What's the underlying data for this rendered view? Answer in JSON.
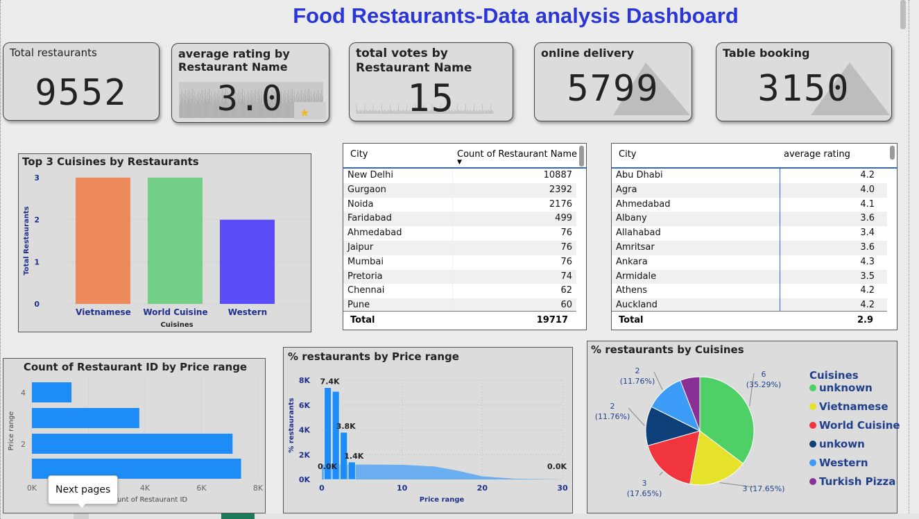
{
  "dashboard": {
    "title": "Food Restaurants-Data analysis Dashboard"
  },
  "kpis": {
    "total_restaurants": {
      "label": "Total restaurants",
      "value": "9552"
    },
    "avg_rating": {
      "label": "average rating by Restaurant Name",
      "value": "3.0"
    },
    "total_votes": {
      "label": "total votes by Restaurant Name",
      "value": "15"
    },
    "online_delivery": {
      "label": "online delivery",
      "value": "5799"
    },
    "table_booking": {
      "label": "Table booking",
      "value": "3150"
    }
  },
  "cuisines_chart": {
    "chart_data": {
      "type": "bar",
      "title": "Top 3 Cuisines by Restaurants",
      "categories": [
        "Vietnamese",
        "World Cuisine",
        "Western"
      ],
      "values": [
        3,
        3,
        2
      ],
      "xlabel": "Cuisines",
      "ylabel": "Total Restaurants",
      "ylim": [
        0,
        3
      ],
      "yticks": [
        "0",
        "1",
        "2",
        "3"
      ],
      "colors": [
        "#ec8a5c",
        "#72cf85",
        "#5a4cf6"
      ]
    }
  },
  "city_count_table": {
    "col1": "City",
    "col2": "Count of Restaurant Name",
    "rows": [
      {
        "city": "New Delhi",
        "value": "10887"
      },
      {
        "city": "Gurgaon",
        "value": "2392"
      },
      {
        "city": "Noida",
        "value": "2176"
      },
      {
        "city": "Faridabad",
        "value": "499"
      },
      {
        "city": "Ahmedabad",
        "value": "76"
      },
      {
        "city": "Jaipur",
        "value": "76"
      },
      {
        "city": "Mumbai",
        "value": "76"
      },
      {
        "city": "Pretoria",
        "value": "74"
      },
      {
        "city": "Chennai",
        "value": "62"
      },
      {
        "city": "Pune",
        "value": "60"
      }
    ],
    "total_label": "Total",
    "total_value": "19717"
  },
  "city_rating_table": {
    "col1": "City",
    "col2": "average rating",
    "rows": [
      {
        "city": "Abu Dhabi",
        "value": "4.2"
      },
      {
        "city": "Agra",
        "value": "4.0"
      },
      {
        "city": "Ahmedabad",
        "value": "4.1"
      },
      {
        "city": "Albany",
        "value": "3.6"
      },
      {
        "city": "Allahabad",
        "value": "3.4"
      },
      {
        "city": "Amritsar",
        "value": "3.6"
      },
      {
        "city": "Ankara",
        "value": "4.3"
      },
      {
        "city": "Armidale",
        "value": "3.5"
      },
      {
        "city": "Athens",
        "value": "4.2"
      },
      {
        "city": "Auckland",
        "value": "4.2"
      }
    ],
    "total_label": "Total",
    "total_value": "2.9"
  },
  "price_range_bar": {
    "chart_data": {
      "type": "bar",
      "orientation": "horizontal",
      "title": "Count of Restaurant ID by Price range",
      "categories": [
        "4",
        "3",
        "2",
        "1"
      ],
      "values": [
        1400,
        3800,
        7100,
        7400
      ],
      "xlabel": "Count of Restaurant ID",
      "ylabel": "Price range",
      "xlim": [
        0,
        8000
      ],
      "xticks": [
        "0K",
        "2K",
        "4K",
        "6K",
        "8K"
      ],
      "yticks": [
        "4",
        "2"
      ],
      "color": "#1e8cf6"
    }
  },
  "price_range_pct": {
    "chart_data": {
      "type": "area",
      "title": "% restaurants by Price range",
      "xlabel": "Price range",
      "ylabel": "% restaurants",
      "xlim": [
        0,
        30
      ],
      "ylim": [
        0,
        8000
      ],
      "xticks": [
        "0",
        "10",
        "20",
        "30"
      ],
      "yticks": [
        "0K",
        "2K",
        "4K",
        "6K",
        "8K"
      ],
      "bars": [
        {
          "x": 1,
          "value": 7400
        },
        {
          "x": 2,
          "value": 7100
        },
        {
          "x": 3,
          "value": 3800
        },
        {
          "x": 4,
          "value": 1400
        }
      ],
      "area": [
        [
          0,
          1200
        ],
        [
          4,
          1200
        ],
        [
          10,
          1180
        ],
        [
          14,
          1050
        ],
        [
          17,
          700
        ],
        [
          20,
          250
        ],
        [
          24,
          60
        ],
        [
          30,
          0
        ]
      ],
      "data_labels": [
        {
          "x": 1,
          "value": 7400,
          "text": "7.4K"
        },
        {
          "x": 3,
          "value": 3800,
          "text": "3.8K"
        },
        {
          "x": 4,
          "value": 1400,
          "text": "1.4K"
        },
        {
          "x": 0,
          "value": 0,
          "text": "0.0K"
        },
        {
          "x": 30,
          "value": 0,
          "text": "0.0K"
        }
      ],
      "color": "#1e8cf6",
      "area_color": "#6aaef0"
    }
  },
  "cuisines_pie": {
    "chart_data": {
      "type": "pie",
      "title": "% restaurants by Cuisines",
      "legend_title": "Cuisines",
      "slices": [
        {
          "name": "unknown",
          "value": 6,
          "label": "6\n(35.29%)",
          "color": "#4fd066"
        },
        {
          "name": "Vietnamese",
          "value": 3,
          "label": "3 (17.65%)",
          "color": "#e6e22c"
        },
        {
          "name": "World Cuisine",
          "value": 3,
          "label": "3\n(17.65%)",
          "color": "#f1353f"
        },
        {
          "name": "unkown",
          "value": 2,
          "label": "2\n(11.76%)",
          "color": "#0d3f78"
        },
        {
          "name": "Western",
          "value": 2,
          "label": "2\n(11.76%)",
          "color": "#3b9bf6"
        },
        {
          "name": "Turkish Pizza",
          "value": 1,
          "label": "",
          "color": "#8a2f96"
        }
      ]
    }
  },
  "tooltip": {
    "text": "Next pages"
  }
}
